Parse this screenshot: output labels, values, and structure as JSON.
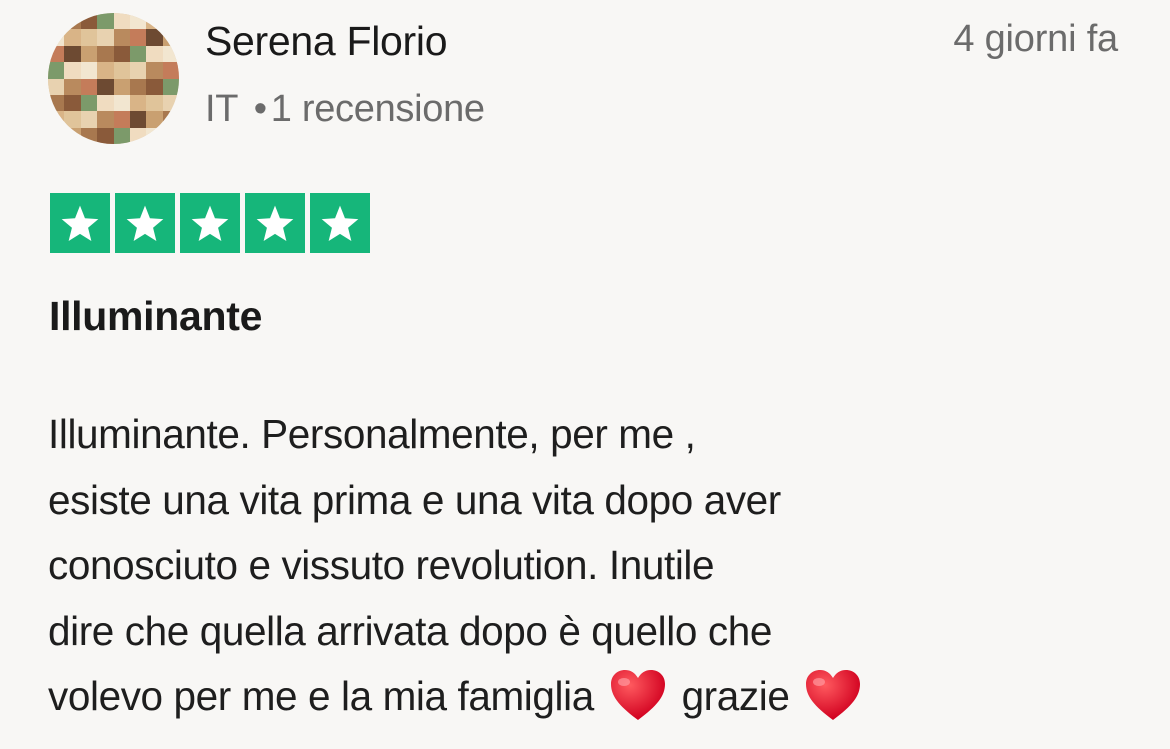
{
  "reviewer": {
    "name": "Serena Florio",
    "country": "IT",
    "separator": "•",
    "review_count": "1 recensione"
  },
  "date": "4 giorni fa",
  "rating": {
    "value": 5,
    "max": 5,
    "color": "#16b67a",
    "icon": "star-icon"
  },
  "review": {
    "title": "Illuminante",
    "lines": [
      "Illuminante. Personalmente, per me ,",
      "esiste una vita prima e una vita dopo aver",
      "conosciuto e vissuto revolution. Inutile",
      "dire che quella arrivata dopo è quello che",
      "volevo per me e la mia famiglia"
    ],
    "closing": "grazie",
    "emoji": "heart-icon"
  }
}
